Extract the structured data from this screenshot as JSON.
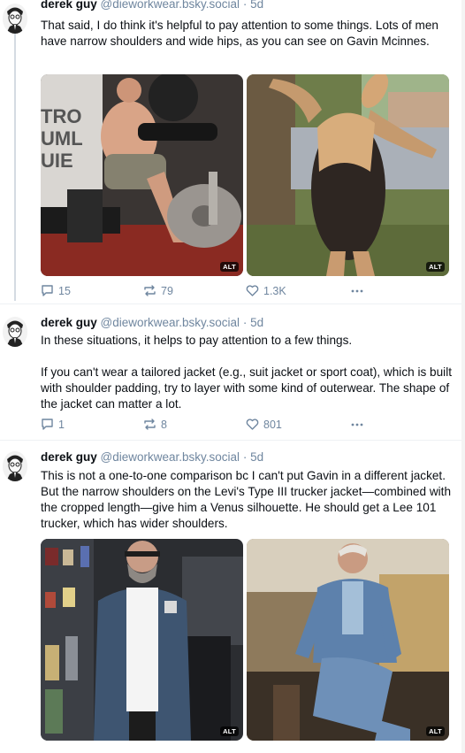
{
  "posts": [
    {
      "author": {
        "name": "derek guy",
        "handle": "@dieworkwear.bsky.social",
        "time": "5d"
      },
      "text": [
        "That said, I do think it's helpful to pay attention to some things. Lots of men have narrow shoulders and wide hips, as you can see on Gavin Mcinnes."
      ],
      "images": [
        {
          "alt_label": "ALT",
          "subject": "man-in-gym-photo"
        },
        {
          "alt_label": "ALT",
          "subject": "tamandua-standing-photo"
        }
      ],
      "stats": {
        "replies": "15",
        "reposts": "79",
        "likes": "1.3K"
      }
    },
    {
      "author": {
        "name": "derek guy",
        "handle": "@dieworkwear.bsky.social",
        "time": "5d"
      },
      "text": [
        "In these situations, it helps to pay attention to a few things.",
        "If you can't wear a tailored jacket (e.g., suit jacket or sport coat), which is built with shoulder padding, try to layer with some kind of outerwear. The shape of the jacket can matter a lot."
      ],
      "stats": {
        "replies": "1",
        "reposts": "8",
        "likes": "801"
      }
    },
    {
      "author": {
        "name": "derek guy",
        "handle": "@dieworkwear.bsky.social",
        "time": "5d"
      },
      "text": [
        "This is not a one-to-one comparison bc I can't put Gavin in a different jacket. But the narrow shoulders on the Levi's Type III trucker jacket—combined with the cropped length—give him a Venus silhouette. He should get a Lee 101 trucker, which has wider shoulders."
      ],
      "images": [
        {
          "alt_label": "ALT",
          "subject": "man-denim-jacket-store-photo"
        },
        {
          "alt_label": "ALT",
          "subject": "man-denim-jacket-hay-photo"
        }
      ]
    }
  ],
  "colors": {
    "muted": "#6f869f",
    "text": "#0b0f14",
    "thread_line": "#d4dbe2"
  }
}
